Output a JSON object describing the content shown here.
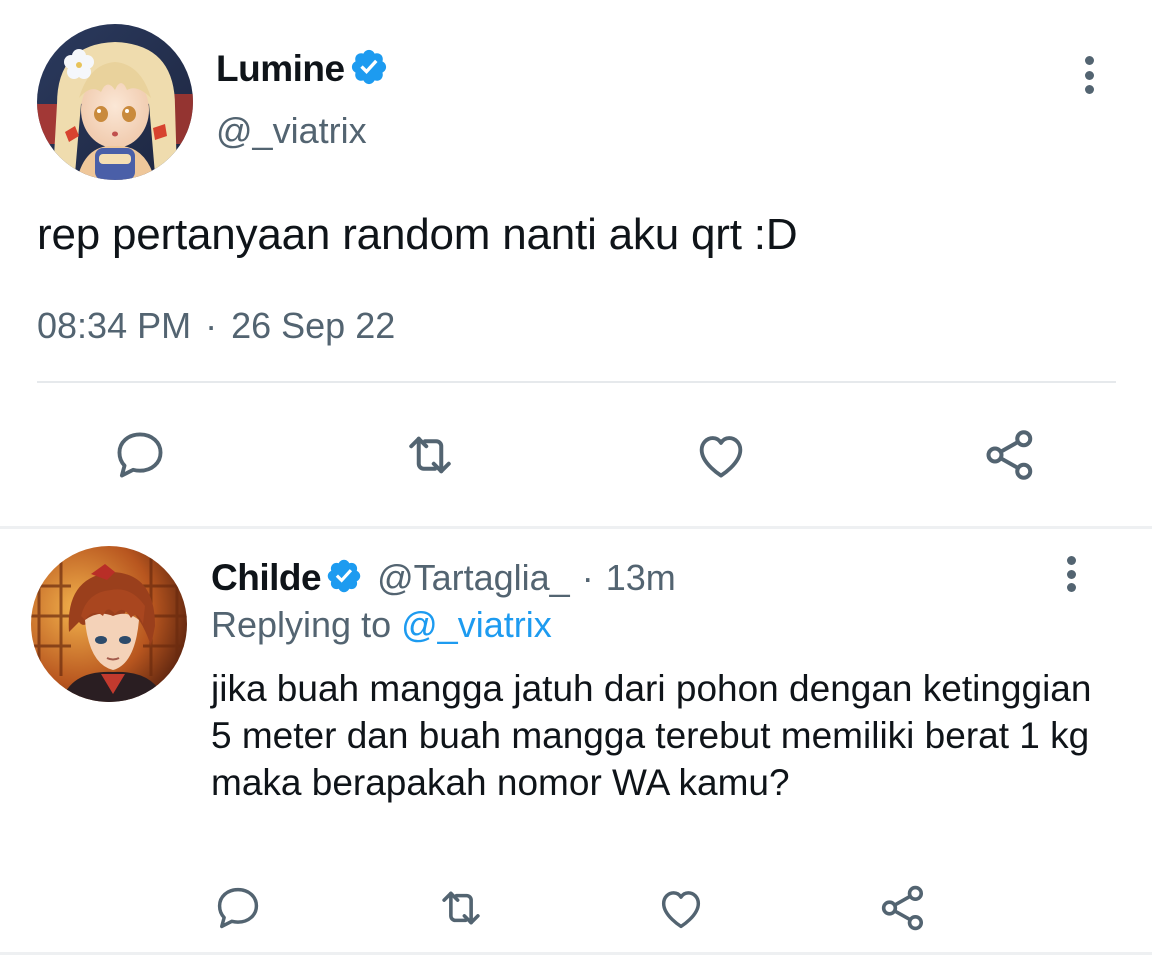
{
  "main_tweet": {
    "author_name": "Lumine",
    "author_handle": "@_viatrix",
    "text": "rep pertanyaan random nanti aku qrt :D",
    "time": "08:34 PM",
    "separator": "·",
    "date": "26 Sep 22",
    "verified": true,
    "actions": [
      "reply-icon",
      "retweet-icon",
      "like-icon",
      "share-icon"
    ]
  },
  "reply_tweet": {
    "author_name": "Childe",
    "author_handle": "@Tartaglia_",
    "separator": "·",
    "time_ago": "13m",
    "replying_label": "Replying to",
    "replying_handle": "@_viatrix",
    "text": "jika buah mangga jatuh dari pohon dengan ketinggian 5 meter dan buah mangga terebut memiliki berat 1 kg maka berapakah nomor WA kamu?",
    "verified": true,
    "actions": [
      "reply-icon",
      "retweet-icon",
      "like-icon",
      "share-icon"
    ]
  },
  "colors": {
    "text_primary": "#0f1419",
    "text_secondary": "#536471",
    "link": "#1d9bf0",
    "verified_badge": "#1d9bf0",
    "divider": "#e6e9ec"
  }
}
